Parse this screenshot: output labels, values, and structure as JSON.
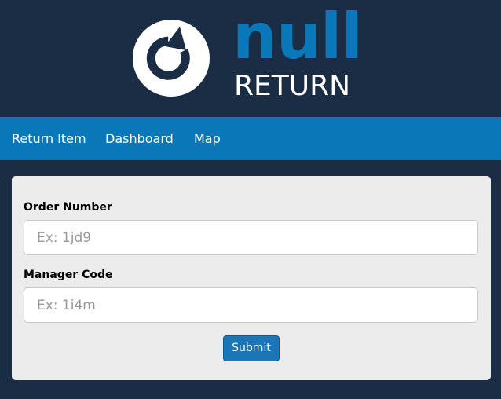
{
  "brand": {
    "name_top": "null",
    "name_bottom": "RETURN",
    "logo_icon": "refresh-arrow-icon",
    "colors": {
      "primary": "#0a78b8",
      "dark": "#1b2d44",
      "text_light": "#ffffff"
    }
  },
  "nav": {
    "items": [
      {
        "label": "Return Item"
      },
      {
        "label": "Dashboard"
      },
      {
        "label": "Map"
      }
    ]
  },
  "form": {
    "order_number": {
      "label": "Order Number",
      "placeholder": "Ex: 1jd9",
      "value": ""
    },
    "manager_code": {
      "label": "Manager Code",
      "placeholder": "Ex: 1i4m",
      "value": ""
    },
    "submit_label": "Submit",
    "card_background": "#ececec",
    "button_color": "#1b76b7"
  }
}
